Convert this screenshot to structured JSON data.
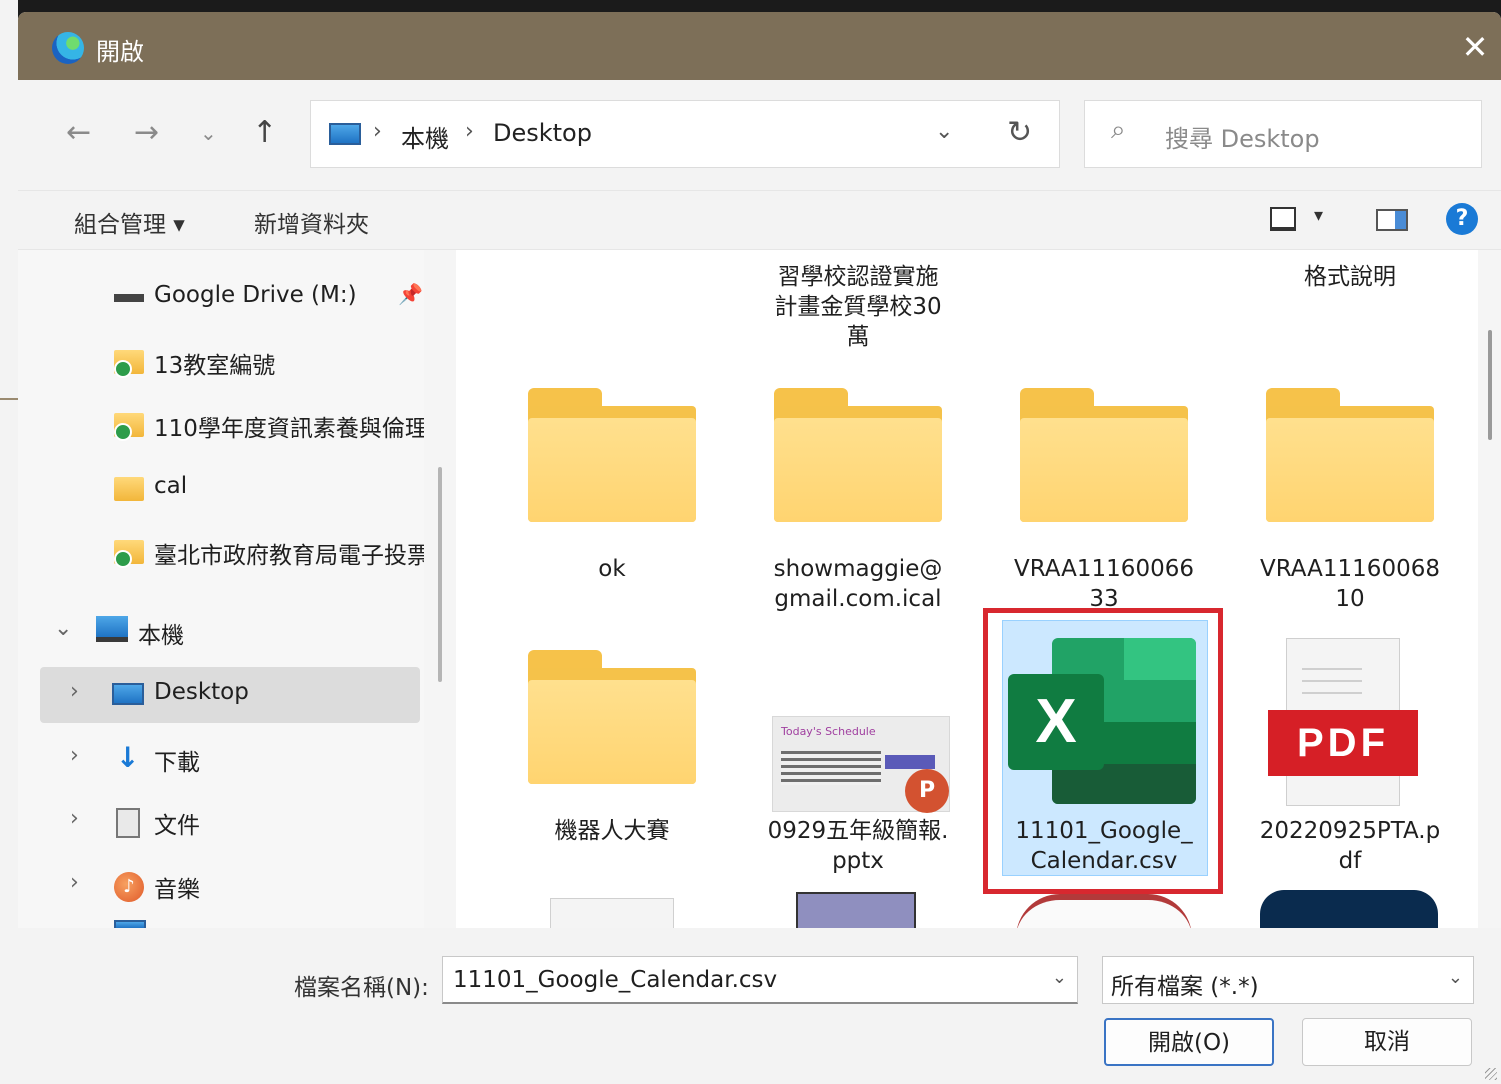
{
  "window": {
    "title": "開啟",
    "close_glyph": "✕"
  },
  "nav": {
    "back": "←",
    "forward": "→",
    "recent": "⌄",
    "up": "↑"
  },
  "address": {
    "crumbs": [
      "本機",
      "Desktop"
    ],
    "separator": "›",
    "dropdown": "⌄",
    "refresh": "↻"
  },
  "search": {
    "icon": "⌕",
    "placeholder": "搜尋 Desktop"
  },
  "toolbar": {
    "organize": "組合管理 ▾",
    "new_folder": "新增資料夾",
    "view_caret": "▾",
    "help": "?"
  },
  "sidebar": {
    "items": [
      {
        "label": "Google Drive (M:)",
        "icon": "drive-icon",
        "pinned": true
      },
      {
        "label": "13教室編號",
        "icon": "folder-sync-icon"
      },
      {
        "label": "110學年度資訊素養與倫理",
        "icon": "folder-sync-icon"
      },
      {
        "label": "cal",
        "icon": "folder-icon"
      },
      {
        "label": "臺北市政府教育局電子投票",
        "icon": "folder-sync-icon"
      },
      {
        "label": "本機",
        "icon": "computer-icon",
        "expanded": true
      },
      {
        "label": "Desktop",
        "icon": "desktop-icon",
        "selected": true
      },
      {
        "label": "下載",
        "icon": "download-icon"
      },
      {
        "label": "文件",
        "icon": "document-icon"
      },
      {
        "label": "音樂",
        "icon": "music-icon"
      }
    ],
    "chevron_collapsed": "›",
    "chevron_expanded": "⌄",
    "pin_glyph": "📌"
  },
  "files": {
    "partial_top": [
      {
        "label": "習學校認證實施\n計畫金質學校30\n萬"
      },
      {
        "label": "格式說明"
      }
    ],
    "row1": [
      {
        "label": "ok",
        "type": "folder"
      },
      {
        "label": "showmaggie@\ngmail.com.ical",
        "type": "folder"
      },
      {
        "label": "VRAA11160066\n33",
        "type": "folder"
      },
      {
        "label": "VRAA11160068\n10",
        "type": "folder"
      }
    ],
    "row2": [
      {
        "label": "機器人大賽",
        "type": "folder"
      },
      {
        "label": "0929五年級簡報.\npptx",
        "type": "pptx",
        "thumb_header": "Today's Schedule"
      },
      {
        "label": "11101_Google_\nCalendar.csv",
        "type": "excel",
        "selected": true,
        "badge": "X"
      },
      {
        "label": "20220925PTA.p\ndf",
        "type": "pdf",
        "badge": "PDF"
      }
    ],
    "ppt_logo": "P"
  },
  "bottom": {
    "filename_label": "檔案名稱(N):",
    "filename_value": "11101_Google_Calendar.csv",
    "filetype_value": "所有檔案 (*.*)",
    "dropdown": "⌄",
    "open_button": "開啟(O)",
    "cancel_button": "取消"
  }
}
